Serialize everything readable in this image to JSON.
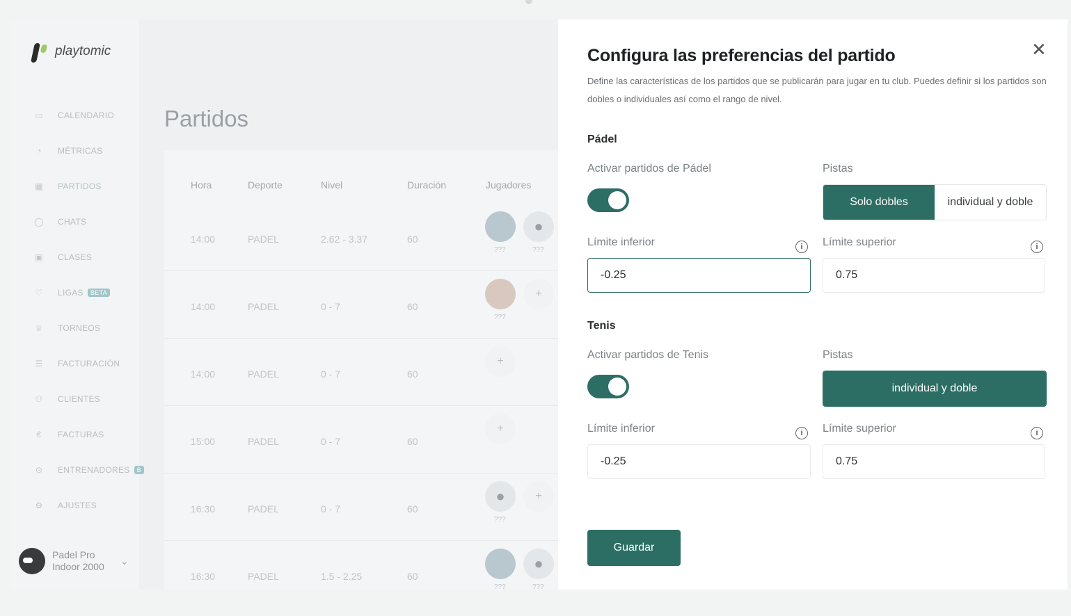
{
  "app": {
    "logo_text": "playtomic",
    "nav": [
      {
        "label": "CALENDARIO",
        "icon": "calendar-icon"
      },
      {
        "label": "MÉTRICAS",
        "icon": "metrics-icon"
      },
      {
        "label": "PARTIDOS",
        "icon": "grid-icon"
      },
      {
        "label": "CHATS",
        "icon": "chat-icon"
      },
      {
        "label": "CLASES",
        "icon": "ticket-icon"
      },
      {
        "label": "LIGAS",
        "icon": "trophy-badge-icon",
        "badge": "BETA"
      },
      {
        "label": "TORNEOS",
        "icon": "trophy-icon"
      },
      {
        "label": "FACTURACIÓN",
        "icon": "database-icon"
      },
      {
        "label": "CLIENTES",
        "icon": "users-icon"
      },
      {
        "label": "FACTURAS",
        "icon": "euro-icon"
      },
      {
        "label": "ENTRENADORES",
        "icon": "whistle-icon",
        "badge": "B"
      },
      {
        "label": "AJUSTES",
        "icon": "gear-icon"
      }
    ],
    "club_name": "Padel Pro Indoor 2000",
    "page_title": "Partidos",
    "table": {
      "headers": [
        "Hora",
        "Deporte",
        "Nivel",
        "Duración",
        "Jugadores"
      ],
      "rows": [
        {
          "hora": "14:00",
          "deporte": "PADEL",
          "nivel": "2.62 - 3.37",
          "duracion": "60",
          "p1": "photo",
          "p2": "ghost",
          "q1": "???",
          "q2": "???"
        },
        {
          "hora": "14:00",
          "deporte": "PADEL",
          "nivel": "0 - 7",
          "duracion": "60",
          "p1": "photo2",
          "p2": "plus",
          "q1": "???",
          "q2": ""
        },
        {
          "hora": "14:00",
          "deporte": "PADEL",
          "nivel": "0 - 7",
          "duracion": "60",
          "p1": "plus",
          "p2": "",
          "q1": "",
          "q2": ""
        },
        {
          "hora": "15:00",
          "deporte": "PADEL",
          "nivel": "0 - 7",
          "duracion": "60",
          "p1": "plus",
          "p2": "",
          "q1": "",
          "q2": ""
        },
        {
          "hora": "16:30",
          "deporte": "PADEL",
          "nivel": "0 - 7",
          "duracion": "60",
          "p1": "ghost",
          "p2": "plus",
          "q1": "???",
          "q2": ""
        },
        {
          "hora": "16:30",
          "deporte": "PADEL",
          "nivel": "1.5 - 2.25",
          "duracion": "60",
          "p1": "photo",
          "p2": "ghost",
          "q1": "???",
          "q2": "???"
        }
      ]
    }
  },
  "panel": {
    "title": "Configura las preferencias del partido",
    "description": "Define las características de los partidos que se publicarán para jugar en tu club. Puedes definir si los partidos son dobles o individuales así como el rango de nivel.",
    "padel": {
      "section": "Pádel",
      "activate_label": "Activar partidos de Pádel",
      "activate_on": true,
      "courts_label": "Pistas",
      "courts_options": [
        "Solo dobles",
        "individual y doble"
      ],
      "lower_label": "Límite inferior",
      "lower_value": "-0.25",
      "upper_label": "Límite superior",
      "upper_value": "0.75"
    },
    "tenis": {
      "section": "Tenis",
      "activate_label": "Activar partidos de Tenis",
      "activate_on": true,
      "courts_label": "Pistas",
      "courts_option": "individual y doble",
      "lower_label": "Límite inferior",
      "lower_value": "-0.25",
      "upper_label": "Límite superior",
      "upper_value": "0.75"
    },
    "save_label": "Guardar",
    "info_glyph": "i",
    "close_glyph": "✕"
  },
  "colors": {
    "accent": "#2d6e64"
  }
}
